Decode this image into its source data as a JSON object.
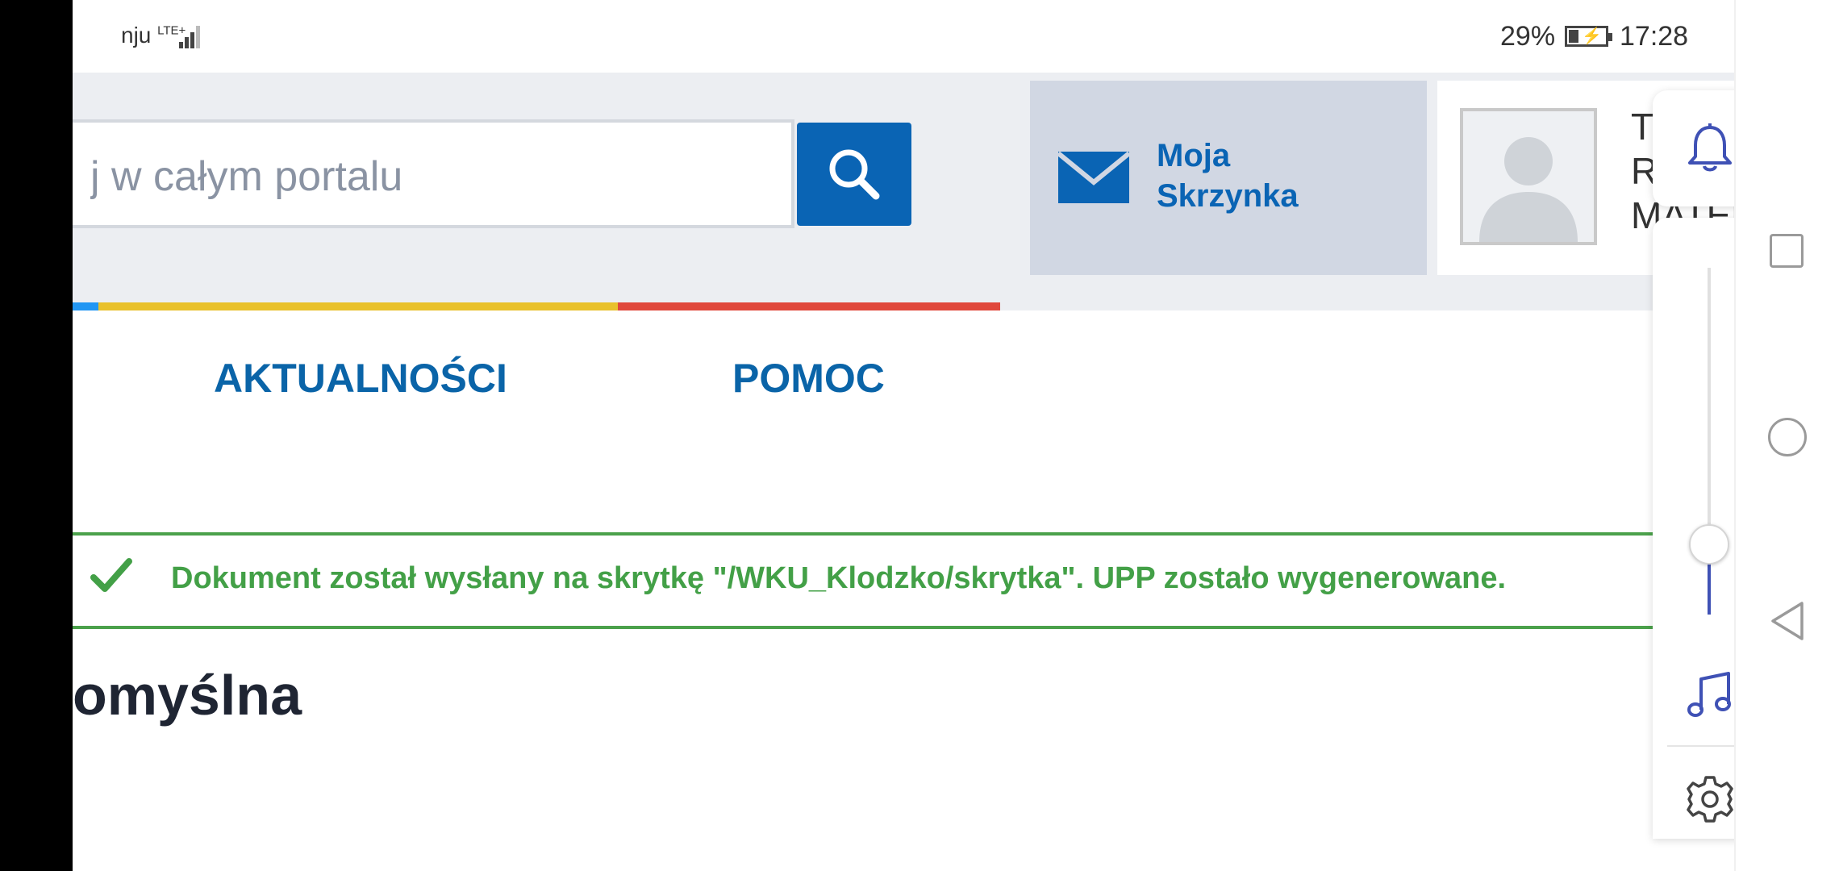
{
  "status_bar": {
    "carrier": "nju",
    "network": "LTE+",
    "battery_percent": "29%",
    "time": "17:28"
  },
  "header": {
    "search": {
      "placeholder": "j w całym portalu",
      "button_icon": "search-icon"
    },
    "mailbox": {
      "icon": "envelope-icon",
      "label_line1": "Moja",
      "label_line2": "Skrzynka"
    },
    "profile": {
      "avatar_icon": "user-silhouette-icon",
      "text_line1": "TE",
      "text_line2": "RTK",
      "text_line3": "MATEU"
    },
    "color_strip_colors": [
      "#2196f3",
      "#e9c12b",
      "#e0483c"
    ]
  },
  "nav": {
    "items": [
      {
        "label": "AKTUALNOŚCI"
      },
      {
        "label": "POMOC"
      }
    ]
  },
  "alert": {
    "icon": "checkmark-icon",
    "text": "Dokument został wysłany na skrytkę \"/WKU_Klodzko/skrytka\". UPP zostało wygenerowane.",
    "color": "#43a047"
  },
  "section": {
    "title": "omyślna"
  },
  "volume_panel": {
    "bell_icon": "bell-icon",
    "level_fraction": 0.21,
    "music_icon": "music-note-icon",
    "settings_icon": "gear-icon",
    "accent": "#3f51b5"
  },
  "system_nav": {
    "recent_icon": "square-icon",
    "home_icon": "circle-icon",
    "back_icon": "triangle-back-icon"
  }
}
